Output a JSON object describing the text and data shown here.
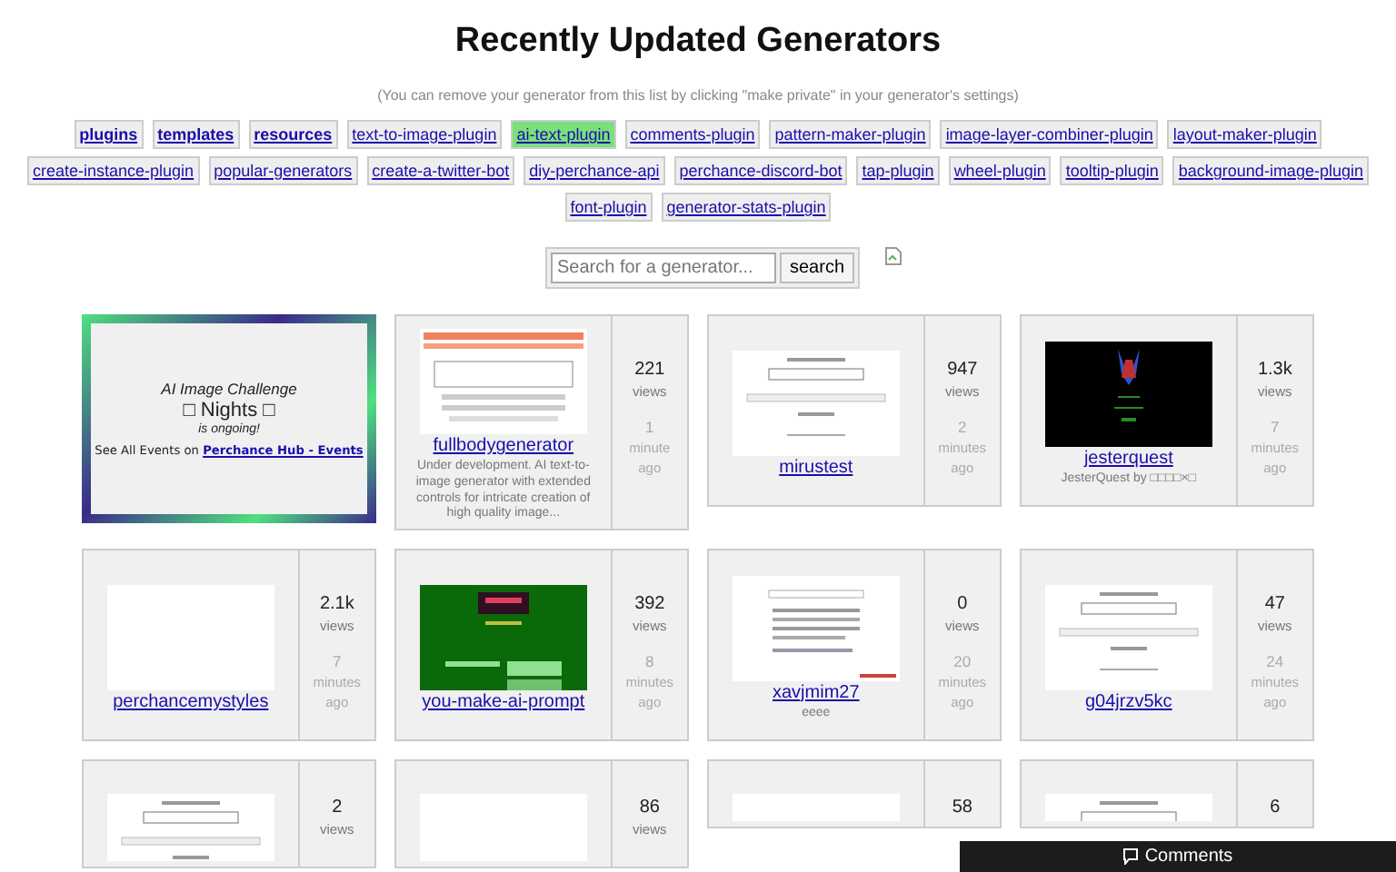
{
  "title": "Recently Updated Generators",
  "subtitle": "(You can remove your generator from this list by clicking \"make private\" in your generator's settings)",
  "tags": [
    {
      "label": "plugins",
      "bold": true,
      "selected": false
    },
    {
      "label": "templates",
      "bold": true,
      "selected": false
    },
    {
      "label": "resources",
      "bold": true,
      "selected": false
    },
    {
      "label": "text-to-image-plugin",
      "bold": false,
      "selected": false
    },
    {
      "label": "ai-text-plugin",
      "bold": false,
      "selected": true
    },
    {
      "label": "comments-plugin",
      "bold": false,
      "selected": false
    },
    {
      "label": "pattern-maker-plugin",
      "bold": false,
      "selected": false
    },
    {
      "label": "image-layer-combiner-plugin",
      "bold": false,
      "selected": false
    },
    {
      "label": "layout-maker-plugin",
      "bold": false,
      "selected": false
    },
    {
      "label": "create-instance-plugin",
      "bold": false,
      "selected": false
    },
    {
      "label": "popular-generators",
      "bold": false,
      "selected": false
    },
    {
      "label": "create-a-twitter-bot",
      "bold": false,
      "selected": false
    },
    {
      "label": "diy-perchance-api",
      "bold": false,
      "selected": false
    },
    {
      "label": "perchance-discord-bot",
      "bold": false,
      "selected": false
    },
    {
      "label": "tap-plugin",
      "bold": false,
      "selected": false
    },
    {
      "label": "wheel-plugin",
      "bold": false,
      "selected": false
    },
    {
      "label": "tooltip-plugin",
      "bold": false,
      "selected": false
    },
    {
      "label": "background-image-plugin",
      "bold": false,
      "selected": false
    },
    {
      "label": "font-plugin",
      "bold": false,
      "selected": false
    },
    {
      "label": "generator-stats-plugin",
      "bold": false,
      "selected": false
    }
  ],
  "search": {
    "placeholder": "Search for a generator...",
    "button": "search"
  },
  "event": {
    "heading": "AI Image Challenge",
    "name": "□ Nights □",
    "status": "is ongoing!",
    "prefix": "See All Events on",
    "link": "Perchance Hub - Events"
  },
  "generators": [
    {
      "name": "fullbodygenerator",
      "description": "Under development. AI text-to-image generator with extended controls for intricate creation of high quality image...",
      "views": "221",
      "views_label": "views",
      "time": "1",
      "time_unit": "minute",
      "time_ago": "ago"
    },
    {
      "name": "mirustest",
      "views": "947",
      "views_label": "views",
      "time": "2",
      "time_unit": "minutes",
      "time_ago": "ago"
    },
    {
      "name": "jesterquest",
      "description": "JesterQuest by □□□□×□",
      "views": "1.3k",
      "views_label": "views",
      "time": "7",
      "time_unit": "minutes",
      "time_ago": "ago"
    },
    {
      "name": "perchancemystyles",
      "views": "2.1k",
      "views_label": "views",
      "time": "7",
      "time_unit": "minutes",
      "time_ago": "ago"
    },
    {
      "name": "you-make-ai-prompt",
      "views": "392",
      "views_label": "views",
      "time": "8",
      "time_unit": "minutes",
      "time_ago": "ago"
    },
    {
      "name": "xavjmim27",
      "description": "eeee",
      "views": "0",
      "views_label": "views",
      "time": "20",
      "time_unit": "minutes",
      "time_ago": "ago"
    },
    {
      "name": "g04jrzv5kc",
      "views": "47",
      "views_label": "views",
      "time": "24",
      "time_unit": "minutes",
      "time_ago": "ago"
    },
    {
      "views": "2",
      "views_label": "views"
    },
    {
      "views": "86",
      "views_label": "views"
    },
    {
      "views": "58"
    },
    {
      "views": "6"
    }
  ],
  "comments": {
    "label": "Comments"
  }
}
